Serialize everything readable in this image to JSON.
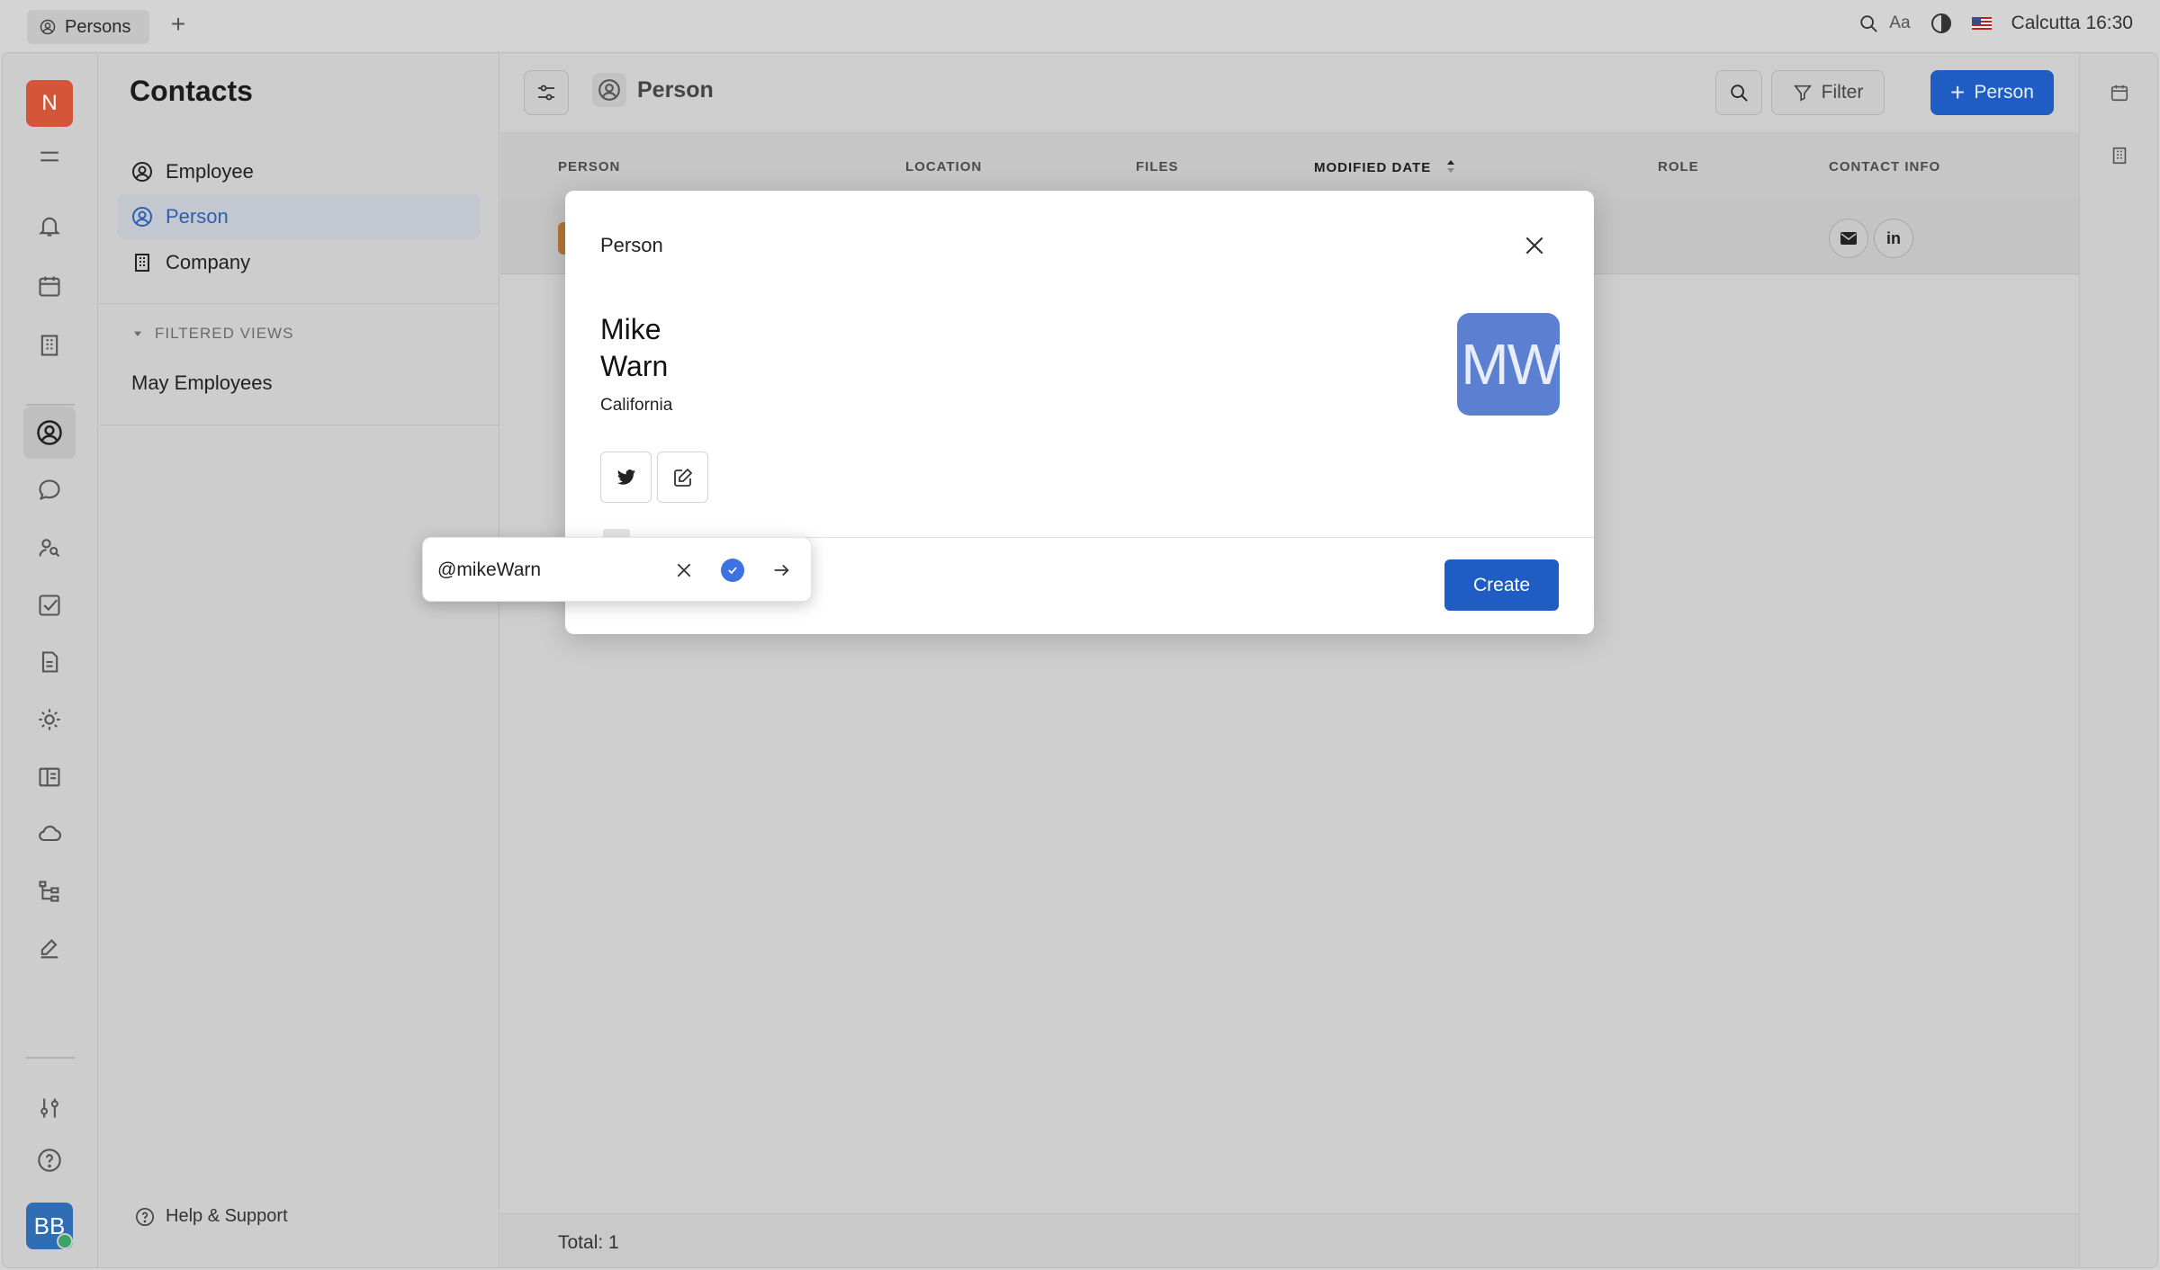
{
  "topbar": {
    "tab_label": "Persons",
    "font_label": "Aa",
    "timezone": "Calcutta",
    "time": "16:30"
  },
  "rail": {
    "workspace_initial": "N",
    "user_initials": "BB"
  },
  "navigator": {
    "title": "Contacts",
    "items": [
      {
        "label": "Employee",
        "icon": "person-circle-icon"
      },
      {
        "label": "Person",
        "icon": "person-circle-icon",
        "selected": true
      },
      {
        "label": "Company",
        "icon": "building-icon"
      }
    ],
    "filtered_views_label": "FILTERED VIEWS",
    "filtered_views": [
      "May Employees"
    ],
    "help_label": "Help & Support"
  },
  "content": {
    "title": "Person",
    "filter_label": "Filter",
    "new_button_label": "Person",
    "columns": [
      "PERSON",
      "LOCATION",
      "FILES",
      "MODIFIED DATE",
      "ROLE",
      "CONTACT INFO"
    ],
    "sorted_column": "MODIFIED DATE",
    "total_label": "Total: 1"
  },
  "dialog": {
    "title": "Person",
    "first_name": "Mike",
    "last_name": "Warn",
    "location": "California",
    "avatar_initials": "MW",
    "create_label": "Create"
  },
  "popup": {
    "value": "@mikeWarn"
  },
  "colors": {
    "accent": "#1f5cc4",
    "workspace_badge": "#d3553a",
    "avatar": "#5b80d2",
    "user_avatar": "#2f6eb4"
  }
}
